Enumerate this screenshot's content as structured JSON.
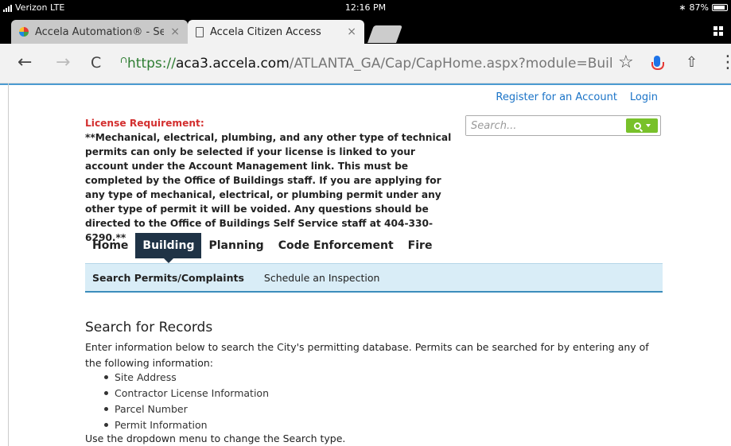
{
  "status_bar": {
    "carrier": "Verizon  LTE",
    "time": "12:16 PM",
    "battery_text": "87%",
    "battery_level": 0.87
  },
  "tabs": [
    {
      "title": "Accela Automation® - Secur",
      "close": "×",
      "active": false
    },
    {
      "title": "Accela Citizen Access",
      "close": "×",
      "active": true
    }
  ],
  "toolbar": {
    "back": "←",
    "forward": "→",
    "reload": "C",
    "star": "☆",
    "share": "⇧",
    "menu": "⋮",
    "url_scheme": "https://",
    "url_host": "aca3.accela.com",
    "url_path": "/ATLANTA_GA/Cap/CapHome.aspx?module=Building&TabName="
  },
  "header_links": {
    "register": "Register for an Account",
    "login": "Login"
  },
  "notice": {
    "title": "License Requirement:",
    "body": "**Mechanical, electrical, plumbing, and any other type of technical permits can only be selected if your license is linked to your account under the Account Management link. This must be completed by the Office of Buildings staff. If you are applying for any type of mechanical, electrical, or plumbing permit under any other type of permit it will be voided.  Any questions should be directed to the Office of Buildings Self Service staff at 404-330-6290.**"
  },
  "search": {
    "placeholder": "Search..."
  },
  "main_nav": [
    "Home",
    "Building",
    "Planning",
    "Code Enforcement",
    "Fire"
  ],
  "active_nav": "Building",
  "sub_nav": [
    "Search Permits/Complaints",
    "Schedule an Inspection"
  ],
  "content": {
    "title": "Search for Records",
    "intro": "Enter information below to search the City's permitting database. Permits can be searched for by entering any of the following information:",
    "bullets": [
      "Site Address",
      "Contractor License Information",
      "Parcel Number",
      "Permit Information"
    ],
    "outro": "Use the dropdown menu to change the Search type."
  },
  "colors": {
    "nav_active": "#1f3346",
    "link": "#1a73c7",
    "notice_title": "#d32f2f",
    "subnav_bg": "#d9edf7",
    "search_button": "#78c12a",
    "secure": "#2e7d32"
  },
  "icons": [
    "signal-icon",
    "battery-icon",
    "accela-favicon-icon",
    "document-icon",
    "tab-switcher-icon",
    "back-icon",
    "forward-icon",
    "reload-icon",
    "lock-icon",
    "star-icon",
    "microphone-icon",
    "share-icon",
    "menu-icon",
    "search-icon",
    "caret-down-icon"
  ]
}
